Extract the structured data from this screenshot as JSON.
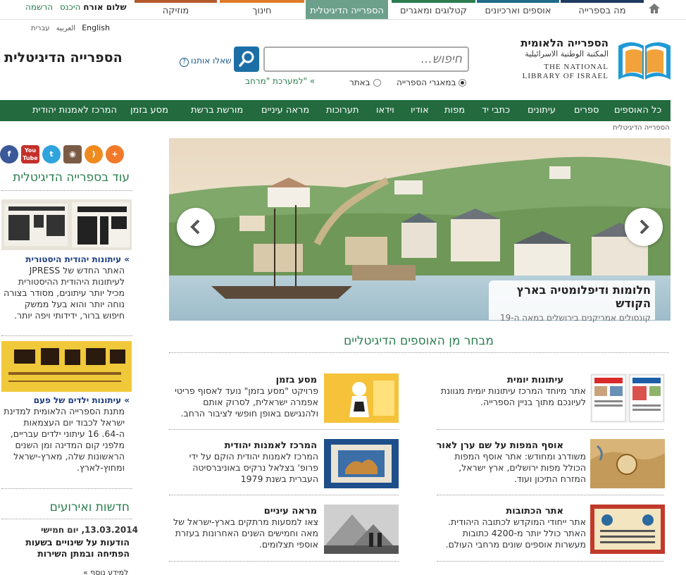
{
  "top_tabs": [
    {
      "label": "מה בספרייה",
      "color": "#1f3a5f"
    },
    {
      "label": "אוספים וארכיונים",
      "color": "#1f6b8a"
    },
    {
      "label": "קטלוגים ומאגרים",
      "color": "#2a7d4f"
    },
    {
      "label": "הספרייה הדיגיטלית",
      "color": "#6ca08b"
    },
    {
      "label": "חינוך",
      "color": "#e07b2a"
    },
    {
      "label": "מוזיקה",
      "color": "#b65a2e"
    }
  ],
  "greeting": {
    "hello": "שלום אורח",
    "login": "היכנס",
    "register": "הרשמה"
  },
  "languages": {
    "en": "English",
    "he": "עברית",
    "ar": "العربية"
  },
  "logo": {
    "he": "הספרייה הלאומית",
    "ar": "المكتبة الوطنية الاسرائيلية",
    "en1": "THE NATIONAL",
    "en2": "LIBRARY OF ISRAEL"
  },
  "site_title": "הספרייה הדיגיטלית",
  "search": {
    "placeholder": "חיפוש...",
    "ask_us": "שאלו אותנו",
    "opt_archive": "במאגרי הספרייה",
    "opt_site": "באתר",
    "merhav": "למערכת \"מרחב\" «"
  },
  "nav": [
    "כל האוספים",
    "ספרים",
    "עיתונים",
    "כתבי יד",
    "מפות",
    "אודיו",
    "וידאו",
    "תערוכות",
    "מראה עיניים",
    "מורשת ברשת",
    "מסע בזמן",
    "המרכז לאמנות יהודית"
  ],
  "breadcrumb": "הספרייה הדיגיטלית",
  "sidebar": {
    "heading": "עוד בספרייה הדיגיטלית",
    "item1_title": "עיתונות יהודית היסטורית «",
    "item1_text": "האתר החדש של JPRESS לעיתונות היהודית ההיסטורית מכיל יותר עיתונים, מסודר בצורה נוחה יותר והוא בעל ממשק חיפוש ברור, ידידותי ויפה יותר.",
    "item2_title": "עיתונות ילדים של פעם «",
    "item2_text": "מתנת הספרייה הלאומית למדינת ישראל לכבוד יום העצמאות ה-64. 16 עיתוני ילדים עבריים, מלפני קום המדינה ומן השנים הראשונות שלה, מארץ-ישראל ומחוץ-לארץ.",
    "news_heading": "חדשות ואירועים",
    "news_date": "13.03.2014, יום חמישי",
    "news_title": "הודעות על שינויים בשעות הפתיחה ובמתן השירות",
    "news_more": "למידע נוסף »"
  },
  "hero": {
    "title": "חלומות ודיפלומטיה בארץ הקודש",
    "subtitle": "קונסולים אמריקנים בירושלים במאה ה-19"
  },
  "section_title": "מבחר מן האוספים הדיגיטליים",
  "cards": [
    {
      "title": "עיתונות יומית",
      "text": "אתר מיוחד המרכז עיתונות יומית מגוונת לעיונכם מתוך בניין הספרייה."
    },
    {
      "title": "מסע בזמן",
      "text": "פרויקט \"מסע בזמן\" נועד לאסוף פריטי אפמרה ישראלית, לסרוק אותם ולהנגישם באופן חופשי לציבור הרחב."
    },
    {
      "title": "אוסף המפות על שם ערן לאור",
      "text": "משודרג ומחודש: אתר אוסף המפות הכולל מפות ירושלים, ארץ ישראל, המזרח התיכון ועוד."
    },
    {
      "title": "המרכז לאמנות יהודית",
      "text": "המרכז לאמנות יהודית הוקם על ידי פרופ' בצלאל נרקיס באוניברסיטה העברית בשנת 1979"
    },
    {
      "title": "אתר הכתובות",
      "text": "אתר ייחודי המוקדש לכתובה היהודית. האתר כולל יותר מ-4200 כתובות מעשרות אוספים שונים מרחבי העולם."
    },
    {
      "title": "מראה עיניים",
      "text": "צאו למסעות מרתקים בארץ-ישראל של מאה וחמישים השנים האחרונות בעזרת אוספי תצלומים."
    }
  ],
  "colors": {
    "green_nav": "#236b3f",
    "accent_green": "#2a7d4f",
    "search_btn": "#1c6fa6"
  }
}
